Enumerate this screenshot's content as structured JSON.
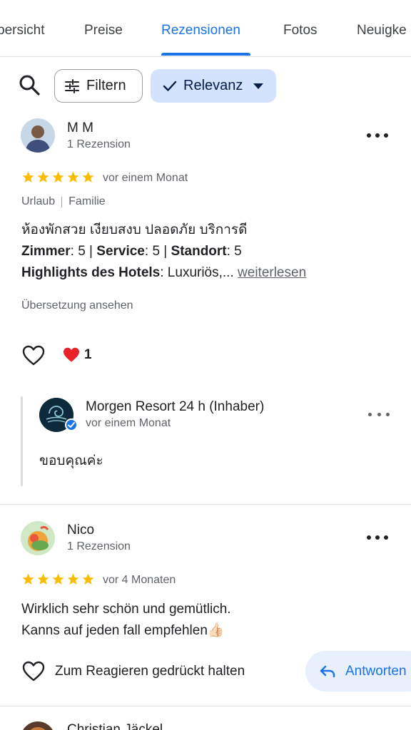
{
  "tabs": [
    {
      "label": "bersicht"
    },
    {
      "label": "Preise"
    },
    {
      "label": "Rezensionen"
    },
    {
      "label": "Fotos"
    },
    {
      "label": "Neuigke"
    }
  ],
  "toolbar": {
    "filter_label": "Filtern",
    "sort_label": "Relevanz"
  },
  "reviews": [
    {
      "author": "M M",
      "review_count": "1 Rezension",
      "rating": 5,
      "date": "vor einem Monat",
      "tags": [
        "Urlaub",
        "Familie"
      ],
      "text_line1": "ห้องพักสวย เงียบสงบ ปลอดภัย บริการดี",
      "ratings_line": {
        "zimmer_label": "Zimmer",
        "zimmer_value": ": 5 | ",
        "service_label": "Service",
        "service_value": ": 5 | ",
        "standort_label": "Standort",
        "standort_value": ": 5"
      },
      "highlights_label": "Highlights des Hotels",
      "highlights_value": ": Luxuriös,... ",
      "read_more": "weiterlesen",
      "translate": "Übersetzung ansehen",
      "reaction_count": "1",
      "owner_reply": {
        "author": "Morgen Resort 24 h (Inhaber)",
        "date": "vor einem Monat",
        "text": "ขอบคุณค่ะ"
      }
    },
    {
      "author": "Nico",
      "review_count": "1 Rezension",
      "rating": 5,
      "date": "vor 4 Monaten",
      "text_line1": "Wirklich sehr schön und gemütlich.",
      "text_line2": "Kanns auf jeden fall empfehlen👍🏻",
      "react_label": "Zum Reagieren gedrückt halten",
      "reply_label": "Antworten"
    },
    {
      "author": "Christian Jäckel"
    }
  ],
  "colors": {
    "accent": "#1a73e8",
    "star": "#fbbc04",
    "sort_chip_bg": "#d3e3fd"
  }
}
